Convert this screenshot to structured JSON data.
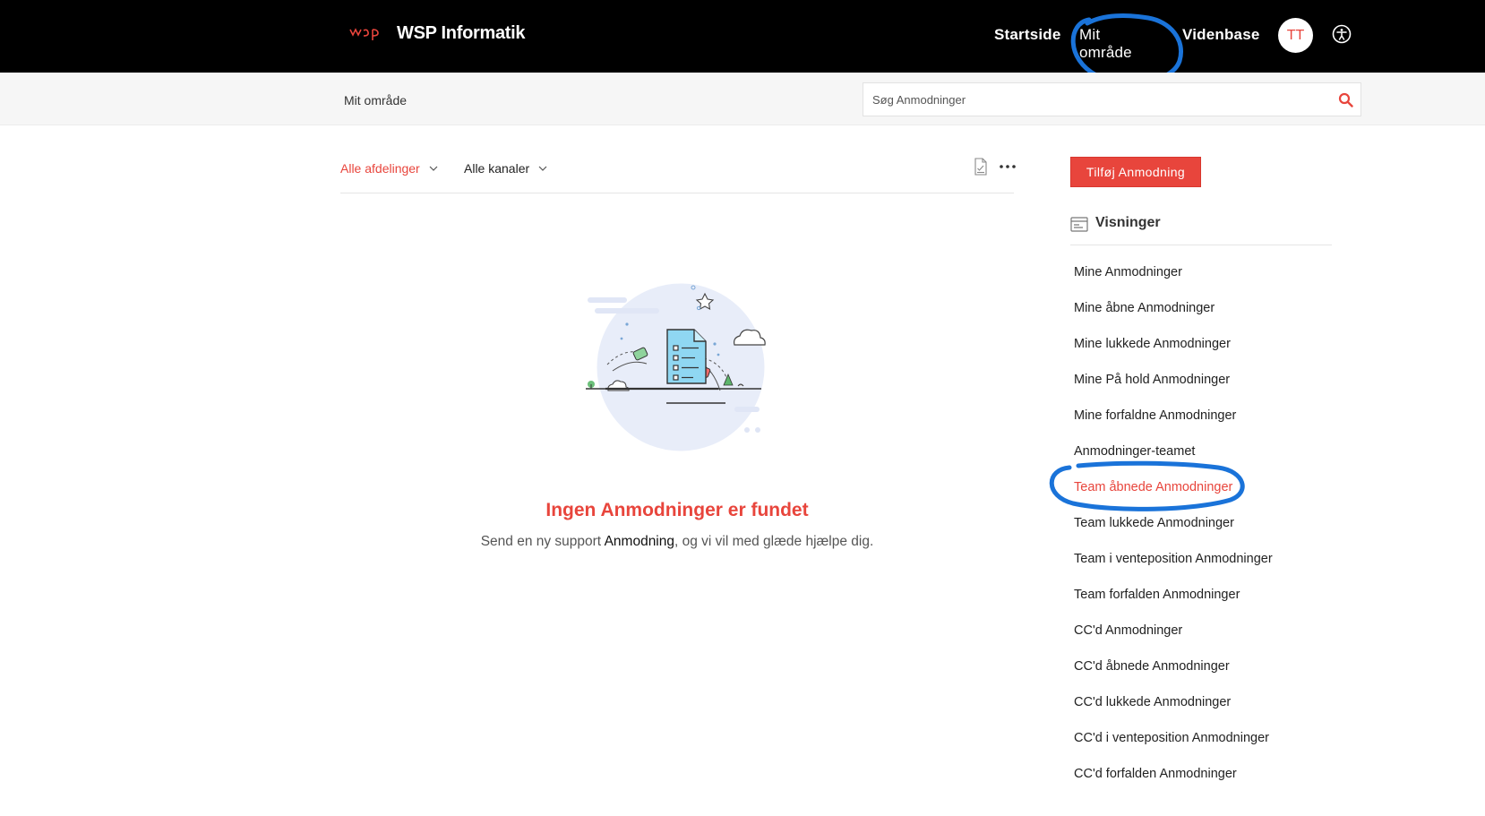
{
  "header": {
    "brand": "WSP Informatik",
    "nav": {
      "home": "Startside",
      "my_area": "Mit område",
      "knowledge_base": "Videnbase"
    },
    "avatar_initials": "TT"
  },
  "subbar": {
    "breadcrumb": "Mit område",
    "search_placeholder": "Søg Anmodninger"
  },
  "filters": {
    "departments": "Alle afdelinger",
    "channels": "Alle kanaler"
  },
  "empty_state": {
    "title": "Ingen Anmodninger er fundet",
    "message_before": "Send en ny support ",
    "message_emphasis": "Anmodning",
    "message_after": ", og vi vil med glæde hjælpe dig."
  },
  "sidebar": {
    "add_button": "Tilføj Anmodning",
    "views_title": "Visninger",
    "views": [
      {
        "label": "Mine Anmodninger",
        "active": false
      },
      {
        "label": "Mine åbne Anmodninger",
        "active": false
      },
      {
        "label": "Mine lukkede Anmodninger",
        "active": false
      },
      {
        "label": "Mine På hold Anmodninger",
        "active": false
      },
      {
        "label": "Mine forfaldne Anmodninger",
        "active": false
      },
      {
        "label": "Anmodninger-teamet",
        "active": false
      },
      {
        "label": "Team åbnede Anmodninger",
        "active": true
      },
      {
        "label": "Team lukkede Anmodninger",
        "active": false
      },
      {
        "label": "Team i venteposition Anmodninger",
        "active": false
      },
      {
        "label": "Team forfalden Anmodninger",
        "active": false
      },
      {
        "label": "CC'd Anmodninger",
        "active": false
      },
      {
        "label": "CC'd åbnede Anmodninger",
        "active": false
      },
      {
        "label": "CC'd lukkede Anmodninger",
        "active": false
      },
      {
        "label": "CC'd i venteposition Anmodninger",
        "active": false
      },
      {
        "label": "CC'd forfalden Anmodninger",
        "active": false
      }
    ]
  },
  "colors": {
    "accent": "#e8453c",
    "header_bg": "#000000",
    "annotation": "#1a73d9"
  }
}
